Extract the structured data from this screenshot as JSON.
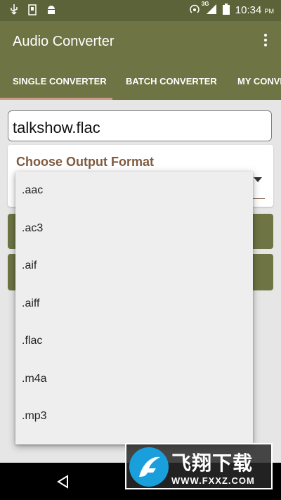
{
  "status_bar": {
    "icons": [
      "usb-icon",
      "sd-card-icon",
      "android-debug-icon",
      "hotspot-icon",
      "signal-3g-icon",
      "battery-icon"
    ],
    "network": "3G",
    "time": "10:34",
    "ampm": "PM"
  },
  "app_bar": {
    "title": "Audio Converter"
  },
  "tabs": [
    {
      "label": "SINGLE CONVERTER"
    },
    {
      "label": "BATCH CONVERTER"
    },
    {
      "label": "MY CONVE"
    }
  ],
  "file_input": {
    "value": "talkshow.flac"
  },
  "format_card": {
    "label": "Choose Output Format"
  },
  "dropdown": {
    "options": [
      ".aac",
      ".ac3",
      ".aif",
      ".aiff",
      ".flac",
      ".m4a",
      ".mp3"
    ]
  },
  "watermark": {
    "cn_text": "飞翔下载",
    "en_text": "WWW.FXXZ.COM"
  },
  "colors": {
    "status_bar": "#5c6338",
    "primary": "#6e7443",
    "accent": "#7f5a3e",
    "tab_indicator": "#c79e86"
  }
}
